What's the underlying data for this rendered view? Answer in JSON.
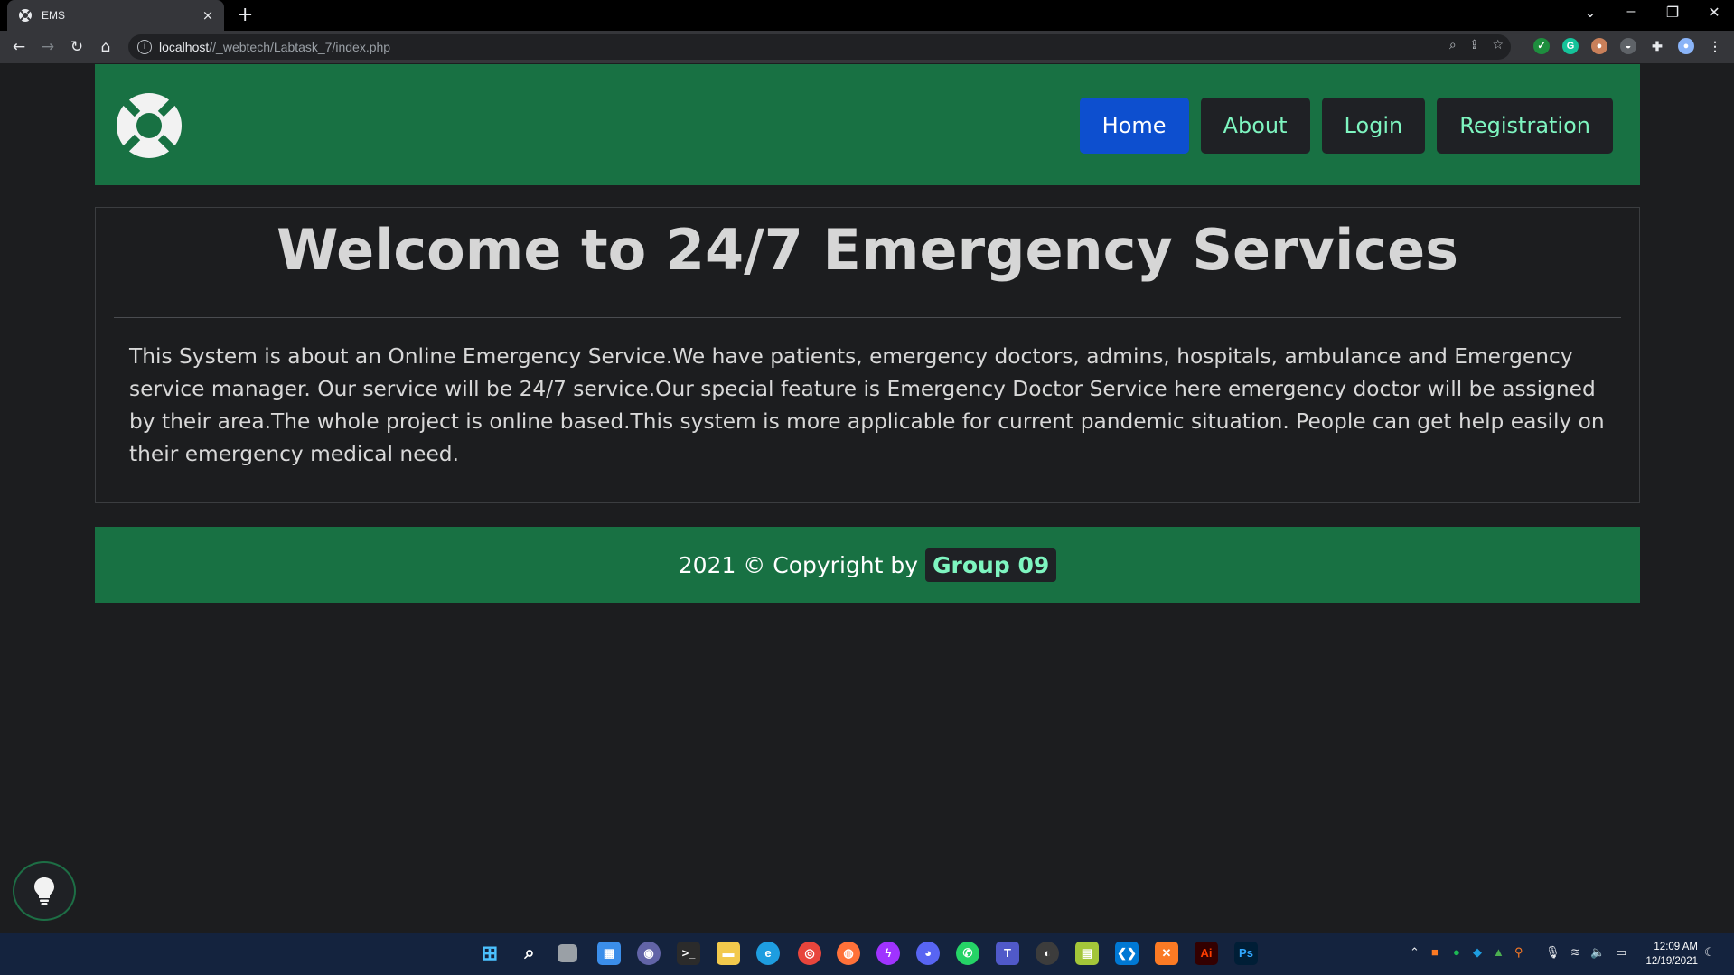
{
  "browser": {
    "tab_title": "EMS",
    "tab_close": "×",
    "new_tab": "+",
    "url_host": "localhost",
    "url_path": "//_webtech/Labtask_7/index.php"
  },
  "header": {
    "nav": [
      {
        "label": "Home",
        "active": true
      },
      {
        "label": "About",
        "active": false
      },
      {
        "label": "Login",
        "active": false
      },
      {
        "label": "Registration",
        "active": false
      }
    ]
  },
  "main": {
    "title_prefix": "Welcome to ",
    "title_bold": "24/7 Emergency Services",
    "body": "This System is about an Online Emergency Service.We have patients, emergency doctors, admins, hospitals, ambulance and Emergency service manager. Our service will be 24/7 service.Our special feature is Emergency Doctor Service here emergency doctor will be assigned by their area.The whole project is online based.This system is more applicable for current pandemic situation. People can get help easily on their emergency medical need."
  },
  "footer": {
    "text": "2021 © Copyright by",
    "badge": "Group 09"
  },
  "taskbar": {
    "time": "12:09 AM",
    "date": "12/19/2021"
  },
  "colors": {
    "header_green": "#187143",
    "active_nav": "#0d4fcf",
    "nav_text": "#7ef5c0",
    "page_bg": "#1c1d1f",
    "taskbar": "#14233e"
  }
}
